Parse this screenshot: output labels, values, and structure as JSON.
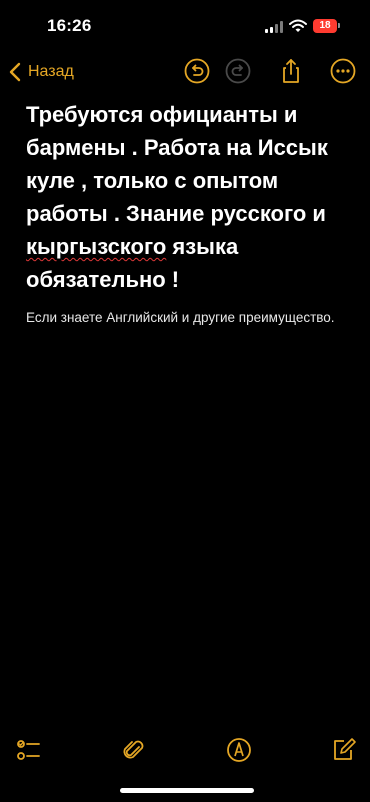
{
  "status_bar": {
    "time": "16:26",
    "battery": "18"
  },
  "nav": {
    "back_label": "Назад",
    "icons": [
      "undo-icon",
      "redo-icon",
      "share-icon",
      "more-icon"
    ]
  },
  "note": {
    "title_part1": "Требуются официанты и бармены . Работа на Иссык куле , только с опытом работы . Знание русского и ",
    "title_misspelled": "кыргызского",
    "title_part2": " языка обязательно !",
    "body": "Если знаете Английский и другие преимущество."
  },
  "toolbar": {
    "icons": [
      "checklist-icon",
      "attachment-icon",
      "markup-icon",
      "compose-icon"
    ]
  },
  "colors": {
    "accent": "#e5a725",
    "background": "#000000",
    "battery": "#ff3b30",
    "spellcheck": "#e03a3a"
  }
}
